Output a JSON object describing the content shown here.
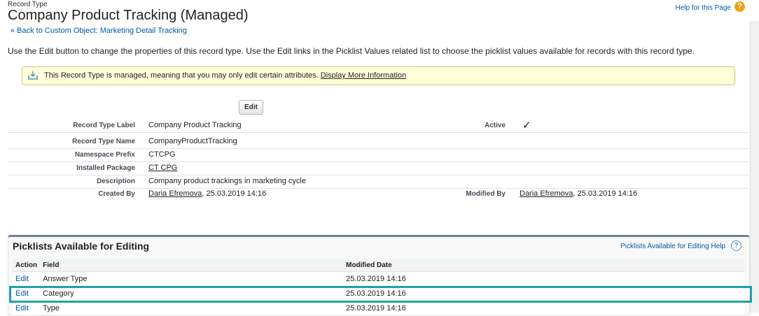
{
  "header": {
    "crumb": "Record Type",
    "title": "Company Product Tracking (Managed)",
    "back_link": "« Back to Custom Object: Marketing Detail Tracking",
    "help_link": "Help for this Page",
    "help_icon": "question-icon"
  },
  "intro": "Use the Edit button to change the properties of this record type. Use the Edit links in the Picklist Values related list to choose the picklist values available for records with this record type.",
  "notice": {
    "text": "This Record Type is managed, meaning that you may only edit certain attributes.",
    "link": "Display More Information",
    "icon": "download-tray-icon"
  },
  "edit_button": "Edit",
  "details": [
    {
      "label": "Record Type Label",
      "value": "Company Product Tracking"
    },
    {
      "label": "Record Type Name",
      "value": "CompanyProductTracking"
    },
    {
      "label": "Namespace Prefix",
      "value": "CTCPG"
    },
    {
      "label": "Installed Package",
      "value": "CT CPG"
    },
    {
      "label": "Description",
      "value": "Company product trackings in marketing cycle"
    },
    {
      "label": "Created By",
      "user": "Daria Efremova",
      "date": ", 25.03.2019 14:16"
    }
  ],
  "active": {
    "label": "Active",
    "icon": "checkmark-icon",
    "value": "✓"
  },
  "modified": {
    "label": "Modified By",
    "user": "Daria Efremova",
    "date": ", 25.03.2019 14:16"
  },
  "picklists": {
    "title": "Picklists Available for Editing",
    "help": "Picklists Available for Editing Help",
    "columns": [
      "Action",
      "Field",
      "Modified Date"
    ],
    "rows": [
      {
        "action": "Edit",
        "field": "Answer Type",
        "date": "25.03.2019 14:16"
      },
      {
        "action": "Edit",
        "field": "Category",
        "date": "25.03.2019 14:16"
      },
      {
        "action": "Edit",
        "field": "Type",
        "date": "25.03.2019 14:16"
      }
    ]
  },
  "colors": {
    "accent": "#20a1a6",
    "link": "#015ba7",
    "notice_bg": "#ffffdc"
  }
}
